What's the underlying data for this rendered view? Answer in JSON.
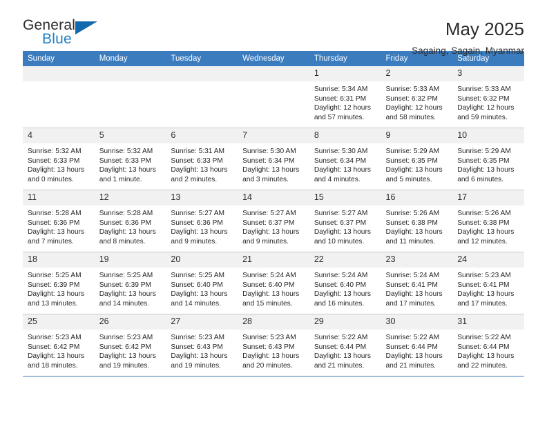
{
  "brand": {
    "name_part1": "General",
    "name_part2": "Blue",
    "flag_icon": "blue-triangle-flag-icon"
  },
  "header": {
    "title": "May 2025",
    "subtitle": "Sagaing, Sagain, Myanmar"
  },
  "colors": {
    "header_blue": "#3b7cbf",
    "brand_blue": "#1f7fc4",
    "daynum_bg": "#f1f1f1",
    "grid_line": "#c8c8c8"
  },
  "weekday_headers": [
    "Sunday",
    "Monday",
    "Tuesday",
    "Wednesday",
    "Thursday",
    "Friday",
    "Saturday"
  ],
  "weeks": [
    [
      {
        "day": "",
        "empty": true,
        "sunrise": "",
        "sunset": "",
        "daylight_line1": "",
        "daylight_line2": ""
      },
      {
        "day": "",
        "empty": true,
        "sunrise": "",
        "sunset": "",
        "daylight_line1": "",
        "daylight_line2": ""
      },
      {
        "day": "",
        "empty": true,
        "sunrise": "",
        "sunset": "",
        "daylight_line1": "",
        "daylight_line2": ""
      },
      {
        "day": "",
        "empty": true,
        "sunrise": "",
        "sunset": "",
        "daylight_line1": "",
        "daylight_line2": ""
      },
      {
        "day": "1",
        "sunrise": "Sunrise: 5:34 AM",
        "sunset": "Sunset: 6:31 PM",
        "daylight_line1": "Daylight: 12 hours",
        "daylight_line2": "and 57 minutes."
      },
      {
        "day": "2",
        "sunrise": "Sunrise: 5:33 AM",
        "sunset": "Sunset: 6:32 PM",
        "daylight_line1": "Daylight: 12 hours",
        "daylight_line2": "and 58 minutes."
      },
      {
        "day": "3",
        "sunrise": "Sunrise: 5:33 AM",
        "sunset": "Sunset: 6:32 PM",
        "daylight_line1": "Daylight: 12 hours",
        "daylight_line2": "and 59 minutes."
      }
    ],
    [
      {
        "day": "4",
        "sunrise": "Sunrise: 5:32 AM",
        "sunset": "Sunset: 6:33 PM",
        "daylight_line1": "Daylight: 13 hours",
        "daylight_line2": "and 0 minutes."
      },
      {
        "day": "5",
        "sunrise": "Sunrise: 5:32 AM",
        "sunset": "Sunset: 6:33 PM",
        "daylight_line1": "Daylight: 13 hours",
        "daylight_line2": "and 1 minute."
      },
      {
        "day": "6",
        "sunrise": "Sunrise: 5:31 AM",
        "sunset": "Sunset: 6:33 PM",
        "daylight_line1": "Daylight: 13 hours",
        "daylight_line2": "and 2 minutes."
      },
      {
        "day": "7",
        "sunrise": "Sunrise: 5:30 AM",
        "sunset": "Sunset: 6:34 PM",
        "daylight_line1": "Daylight: 13 hours",
        "daylight_line2": "and 3 minutes."
      },
      {
        "day": "8",
        "sunrise": "Sunrise: 5:30 AM",
        "sunset": "Sunset: 6:34 PM",
        "daylight_line1": "Daylight: 13 hours",
        "daylight_line2": "and 4 minutes."
      },
      {
        "day": "9",
        "sunrise": "Sunrise: 5:29 AM",
        "sunset": "Sunset: 6:35 PM",
        "daylight_line1": "Daylight: 13 hours",
        "daylight_line2": "and 5 minutes."
      },
      {
        "day": "10",
        "sunrise": "Sunrise: 5:29 AM",
        "sunset": "Sunset: 6:35 PM",
        "daylight_line1": "Daylight: 13 hours",
        "daylight_line2": "and 6 minutes."
      }
    ],
    [
      {
        "day": "11",
        "sunrise": "Sunrise: 5:28 AM",
        "sunset": "Sunset: 6:36 PM",
        "daylight_line1": "Daylight: 13 hours",
        "daylight_line2": "and 7 minutes."
      },
      {
        "day": "12",
        "sunrise": "Sunrise: 5:28 AM",
        "sunset": "Sunset: 6:36 PM",
        "daylight_line1": "Daylight: 13 hours",
        "daylight_line2": "and 8 minutes."
      },
      {
        "day": "13",
        "sunrise": "Sunrise: 5:27 AM",
        "sunset": "Sunset: 6:36 PM",
        "daylight_line1": "Daylight: 13 hours",
        "daylight_line2": "and 9 minutes."
      },
      {
        "day": "14",
        "sunrise": "Sunrise: 5:27 AM",
        "sunset": "Sunset: 6:37 PM",
        "daylight_line1": "Daylight: 13 hours",
        "daylight_line2": "and 9 minutes."
      },
      {
        "day": "15",
        "sunrise": "Sunrise: 5:27 AM",
        "sunset": "Sunset: 6:37 PM",
        "daylight_line1": "Daylight: 13 hours",
        "daylight_line2": "and 10 minutes."
      },
      {
        "day": "16",
        "sunrise": "Sunrise: 5:26 AM",
        "sunset": "Sunset: 6:38 PM",
        "daylight_line1": "Daylight: 13 hours",
        "daylight_line2": "and 11 minutes."
      },
      {
        "day": "17",
        "sunrise": "Sunrise: 5:26 AM",
        "sunset": "Sunset: 6:38 PM",
        "daylight_line1": "Daylight: 13 hours",
        "daylight_line2": "and 12 minutes."
      }
    ],
    [
      {
        "day": "18",
        "sunrise": "Sunrise: 5:25 AM",
        "sunset": "Sunset: 6:39 PM",
        "daylight_line1": "Daylight: 13 hours",
        "daylight_line2": "and 13 minutes."
      },
      {
        "day": "19",
        "sunrise": "Sunrise: 5:25 AM",
        "sunset": "Sunset: 6:39 PM",
        "daylight_line1": "Daylight: 13 hours",
        "daylight_line2": "and 14 minutes."
      },
      {
        "day": "20",
        "sunrise": "Sunrise: 5:25 AM",
        "sunset": "Sunset: 6:40 PM",
        "daylight_line1": "Daylight: 13 hours",
        "daylight_line2": "and 14 minutes."
      },
      {
        "day": "21",
        "sunrise": "Sunrise: 5:24 AM",
        "sunset": "Sunset: 6:40 PM",
        "daylight_line1": "Daylight: 13 hours",
        "daylight_line2": "and 15 minutes."
      },
      {
        "day": "22",
        "sunrise": "Sunrise: 5:24 AM",
        "sunset": "Sunset: 6:40 PM",
        "daylight_line1": "Daylight: 13 hours",
        "daylight_line2": "and 16 minutes."
      },
      {
        "day": "23",
        "sunrise": "Sunrise: 5:24 AM",
        "sunset": "Sunset: 6:41 PM",
        "daylight_line1": "Daylight: 13 hours",
        "daylight_line2": "and 17 minutes."
      },
      {
        "day": "24",
        "sunrise": "Sunrise: 5:23 AM",
        "sunset": "Sunset: 6:41 PM",
        "daylight_line1": "Daylight: 13 hours",
        "daylight_line2": "and 17 minutes."
      }
    ],
    [
      {
        "day": "25",
        "sunrise": "Sunrise: 5:23 AM",
        "sunset": "Sunset: 6:42 PM",
        "daylight_line1": "Daylight: 13 hours",
        "daylight_line2": "and 18 minutes."
      },
      {
        "day": "26",
        "sunrise": "Sunrise: 5:23 AM",
        "sunset": "Sunset: 6:42 PM",
        "daylight_line1": "Daylight: 13 hours",
        "daylight_line2": "and 19 minutes."
      },
      {
        "day": "27",
        "sunrise": "Sunrise: 5:23 AM",
        "sunset": "Sunset: 6:43 PM",
        "daylight_line1": "Daylight: 13 hours",
        "daylight_line2": "and 19 minutes."
      },
      {
        "day": "28",
        "sunrise": "Sunrise: 5:23 AM",
        "sunset": "Sunset: 6:43 PM",
        "daylight_line1": "Daylight: 13 hours",
        "daylight_line2": "and 20 minutes."
      },
      {
        "day": "29",
        "sunrise": "Sunrise: 5:22 AM",
        "sunset": "Sunset: 6:44 PM",
        "daylight_line1": "Daylight: 13 hours",
        "daylight_line2": "and 21 minutes."
      },
      {
        "day": "30",
        "sunrise": "Sunrise: 5:22 AM",
        "sunset": "Sunset: 6:44 PM",
        "daylight_line1": "Daylight: 13 hours",
        "daylight_line2": "and 21 minutes."
      },
      {
        "day": "31",
        "sunrise": "Sunrise: 5:22 AM",
        "sunset": "Sunset: 6:44 PM",
        "daylight_line1": "Daylight: 13 hours",
        "daylight_line2": "and 22 minutes."
      }
    ]
  ]
}
